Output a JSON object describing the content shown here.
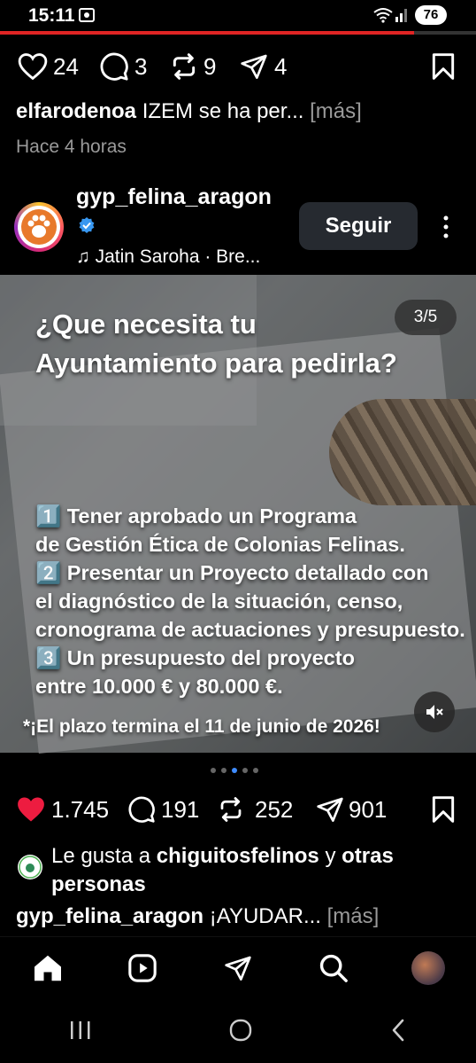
{
  "status_bar": {
    "time": "15:11",
    "battery": "76",
    "screen_progress": 0.87
  },
  "top_actions": {
    "likes": "24",
    "comments": "3",
    "reposts": "9",
    "shares": "4"
  },
  "prev_post": {
    "username": "elfarodenoa",
    "caption": "IZEM se ha per...",
    "more": "[más]",
    "time_ago": "Hace 4 horas"
  },
  "post_header": {
    "username": "gyp_felina_aragon",
    "verified": true,
    "audio": "Jatin Saroha · Bre...",
    "follow_label": "Seguir"
  },
  "post_image": {
    "counter": "3/5",
    "title_lines": [
      "¿Que necesita tu",
      "Ayuntamiento para pedirla?"
    ],
    "body_lines": [
      "1️⃣ Tener aprobado un Programa",
      "de Gestión Ética de Colonias Felinas.",
      "2️⃣ Presentar un Proyecto detallado con",
      "el diagnóstico de la situación, censo,",
      "cronograma de actuaciones y presupuesto.",
      "3️⃣ Un presupuesto del proyecto",
      "entre 10.000 € y 80.000 €."
    ],
    "footnote": "*¡El plazo termina el 11 de junio de 2026!"
  },
  "carousel": {
    "count": 5,
    "active": 3
  },
  "post_actions": {
    "likes": "1.745",
    "comments": "191",
    "reposts": "252",
    "shares": "901"
  },
  "liked_by": {
    "prefix": "Le gusta a",
    "user": "chiguitosfelinos",
    "joiner": "y",
    "others": "otras",
    "others_line2": "personas"
  },
  "post_caption": {
    "username": "gyp_felina_aragon",
    "text": "¡AYUDAR...",
    "more": "[más]"
  },
  "colors": {
    "accent_red": "#e02424",
    "like_red": "#ed1c40",
    "verified_blue": "#3897f0"
  }
}
